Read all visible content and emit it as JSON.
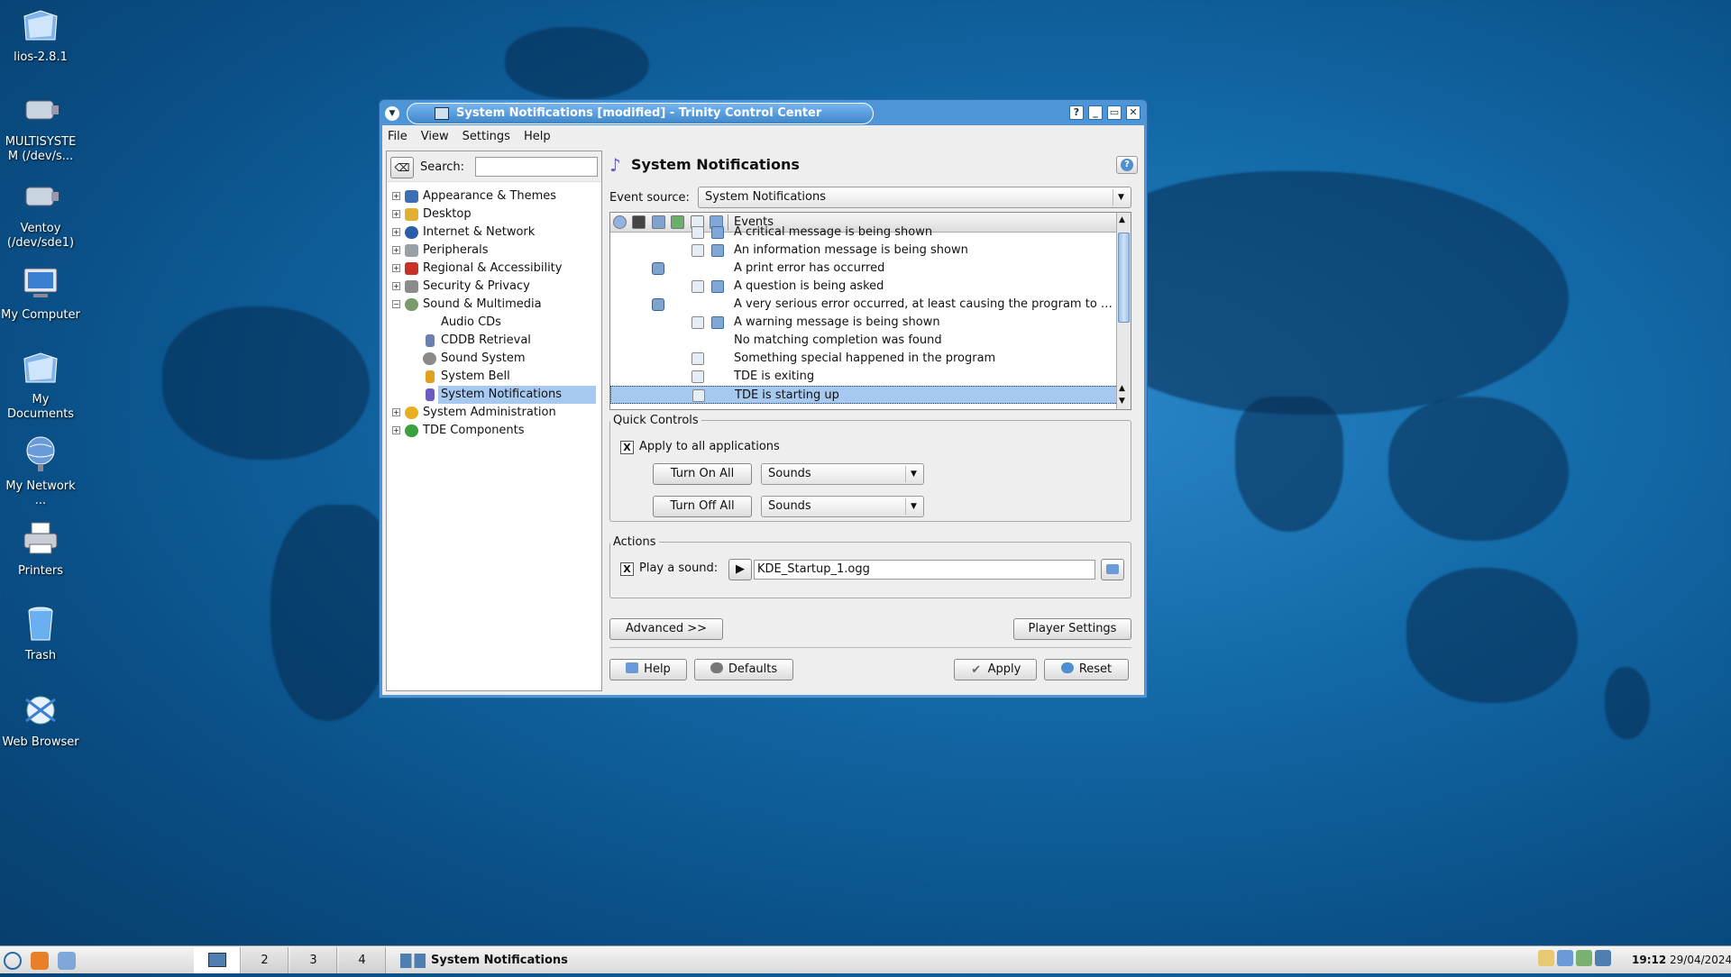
{
  "desktop": {
    "icons": [
      {
        "label": "lios-2.8.1"
      },
      {
        "label": "MULTISYSTE M (/dev/s..."
      },
      {
        "label": "Ventoy (/dev/sde1)"
      },
      {
        "label": "My Computer"
      },
      {
        "label": "My Documents"
      },
      {
        "label": "My Network ..."
      },
      {
        "label": "Printers"
      },
      {
        "label": "Trash"
      },
      {
        "label": "Web Browser"
      }
    ]
  },
  "window": {
    "title": "System Notifications [modified] - Trinity Control Center",
    "buttons": {
      "help": "?",
      "minimize": "_",
      "maximize": "▭",
      "close": "✕"
    }
  },
  "menubar": [
    "File",
    "View",
    "Settings",
    "Help"
  ],
  "search": {
    "label": "Search:",
    "value": ""
  },
  "tree": [
    {
      "label": "Appearance & Themes",
      "color": "#3b6fb5"
    },
    {
      "label": "Desktop",
      "color": "#e0b030"
    },
    {
      "label": "Internet & Network",
      "color": "#2a5ea8"
    },
    {
      "label": "Peripherals",
      "color": "#9aa0a8"
    },
    {
      "label": "Regional & Accessibility",
      "color": "#c83028"
    },
    {
      "label": "Security & Privacy",
      "color": "#8c8c8c"
    },
    {
      "label": "Sound & Multimedia",
      "color": "#7a9a6a"
    },
    {
      "label": "Audio CDs",
      "color": ""
    },
    {
      "label": "CDDB Retrieval",
      "color": "#6a80b0"
    },
    {
      "label": "Sound System",
      "color": "#8a8a8a"
    },
    {
      "label": "System Bell",
      "color": "#e0a020"
    },
    {
      "label": "System Notifications",
      "color": "#6a5cc0"
    },
    {
      "label": "System Administration",
      "color": "#e8b020"
    },
    {
      "label": "TDE Components",
      "color": "#3aa040"
    }
  ],
  "panel": {
    "title": "System Notifications",
    "event_source_label": "Event source:",
    "event_source_value": "System Notifications",
    "events_header": "Events",
    "events": [
      "A critical message is being shown",
      "An information message is being shown",
      "A print error has occurred",
      "A question is being asked",
      "A very serious error occurred, at least causing the program to e...",
      "A warning message is being shown",
      "No matching completion was found",
      "Something special happened in the program",
      "TDE is exiting",
      "TDE is starting up"
    ],
    "quick_controls": {
      "legend": "Quick Controls",
      "apply_all_label": "Apply to all applications",
      "apply_all_checked": "X",
      "turn_on_label": "Turn On All",
      "turn_off_label": "Turn Off All",
      "turn_on_combo": "Sounds",
      "turn_off_combo": "Sounds"
    },
    "actions": {
      "legend": "Actions",
      "play_sound_label": "Play a sound:",
      "play_sound_checked": "X",
      "sound_file": "KDE_Startup_1.ogg"
    },
    "advanced_label": "Advanced >>",
    "player_settings_label": "Player Settings",
    "help_label": "Help",
    "defaults_label": "Defaults",
    "apply_label": "Apply",
    "reset_label": "Reset"
  },
  "taskbar": {
    "desktops": [
      "2",
      "3",
      "4"
    ],
    "task_label": "System Notifications",
    "time": "19:12",
    "date": "29/04/2024"
  }
}
